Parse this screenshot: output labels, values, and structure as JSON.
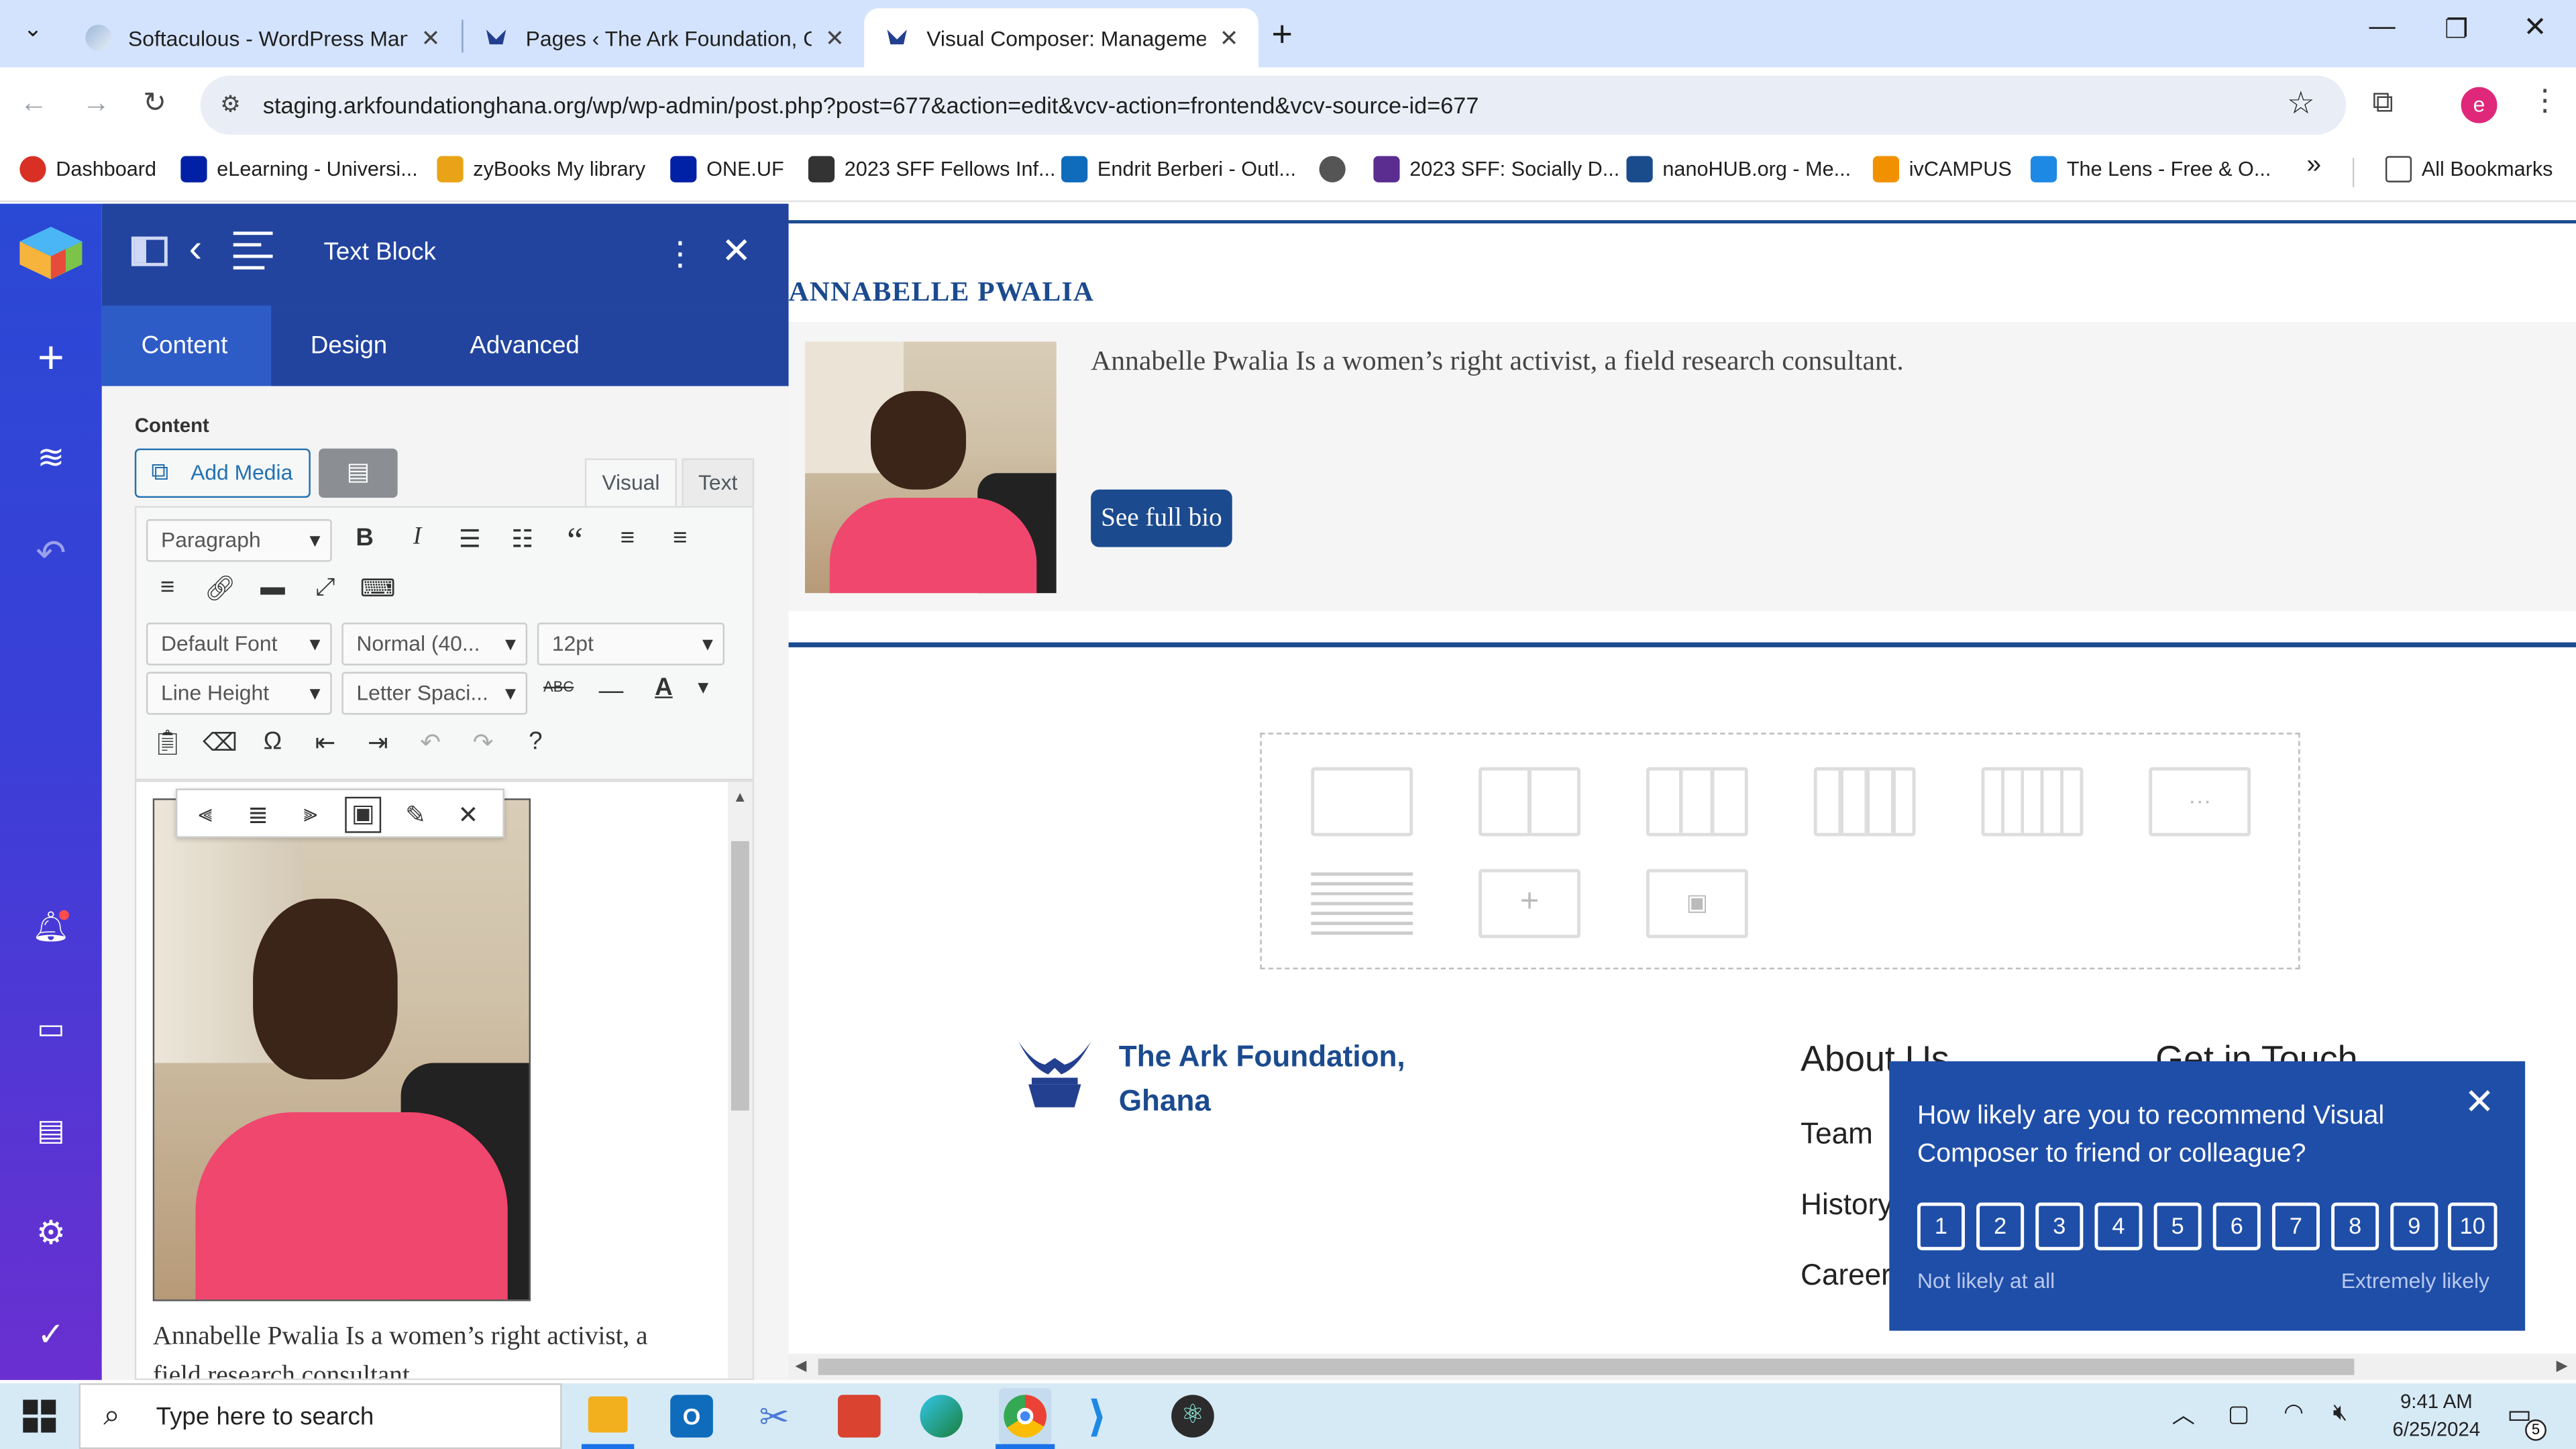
{
  "browser": {
    "tabs": [
      {
        "title": "Softaculous - WordPress Manag",
        "active": false
      },
      {
        "title": "Pages ‹ The Ark Foundation, Gh",
        "active": false
      },
      {
        "title": "Visual Composer: Management",
        "active": true
      }
    ],
    "new_tab_label": "+",
    "url": "staging.arkfoundationghana.org/wp/wp-admin/post.php?post=677&action=edit&vcv-action=frontend&vcv-source-id=677",
    "profile_initial": "e",
    "bookmarks": [
      {
        "label": "Dashboard",
        "color": "#d93025"
      },
      {
        "label": "eLearning - Universi...",
        "color": "#0021a5"
      },
      {
        "label": "zyBooks My library",
        "color": "#e8a317"
      },
      {
        "label": "ONE.UF",
        "color": "#0021a5"
      },
      {
        "label": "2023 SFF Fellows Inf...",
        "color": "#333333"
      },
      {
        "label": "Endrit Berberi - Outl...",
        "color": "#0f6cbd"
      },
      {
        "label": "2023 SFF: Socially D...",
        "color": "#5b2d90"
      },
      {
        "label": "nanoHUB.org - Me...",
        "color": "#1a4c8b"
      },
      {
        "label": "ivCAMPUS",
        "color": "#f29100"
      },
      {
        "label": "The Lens - Free & O...",
        "color": "#1e88e5"
      }
    ],
    "more_bookmarks": "»",
    "all_bookmarks": "All Bookmarks"
  },
  "editor": {
    "panel_title": "Text Block",
    "tabs": [
      "Content",
      "Design",
      "Advanced"
    ],
    "active_tab": "Content",
    "section_label": "Content",
    "add_media": "Add Media",
    "mode_tabs": [
      "Visual",
      "Text"
    ],
    "active_mode": "Visual",
    "format_select": "Paragraph",
    "font_select": "Default Font",
    "weight_select": "Normal (40...",
    "size_select": "12pt",
    "line_height_select": "Line Height",
    "letter_spacing_select": "Letter Spaci...",
    "text_content_line1": "Annabelle Pwalia Is a women’s right activist, a",
    "text_content_line2": "field research consultant"
  },
  "page": {
    "person_name": "ANNABELLE PWALIA",
    "bio": "Annabelle Pwalia Is a women’s right activist, a field research consultant.",
    "bio_button": "See full bio",
    "footer": {
      "org_line1": "The Ark Foundation,",
      "org_line2": "Ghana",
      "about_heading": "About Us",
      "about_links": [
        "Team",
        "History",
        "Careers"
      ],
      "contact_heading": "Get in Touch"
    }
  },
  "survey": {
    "question_line1": "How likely are you to recommend Visual",
    "question_line2": "Composer to friend or colleague?",
    "scale": [
      "1",
      "2",
      "3",
      "4",
      "5",
      "6",
      "7",
      "8",
      "9",
      "10"
    ],
    "low_label": "Not likely at all",
    "high_label": "Extremely likely"
  },
  "taskbar": {
    "search_placeholder": "Type here to search",
    "time": "9:41 AM",
    "date": "6/25/2024",
    "notification_count": "5"
  },
  "colors": {
    "accent_blue": "#22449f",
    "brand_navy": "#1b4a8f",
    "survey_bg": "#1f4ea8"
  }
}
